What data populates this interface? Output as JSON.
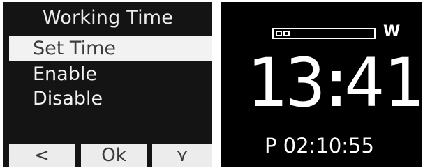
{
  "menu_screen": {
    "title": "Working Time",
    "items": [
      {
        "label": "Set Time",
        "selected": true
      },
      {
        "label": "Enable",
        "selected": false
      },
      {
        "label": "Disable",
        "selected": false
      }
    ],
    "softkeys": {
      "back_label": "<",
      "ok_label": "Ok",
      "down_label": "⋎"
    }
  },
  "clock_screen": {
    "progress_segments_filled": 2,
    "mode_letter": "W",
    "time": {
      "hours": "13",
      "separator": ":",
      "minutes": "41"
    },
    "status_line": "P 02:10:55"
  },
  "colors": {
    "menu_background": "#141414",
    "menu_text": "#f2f2f2",
    "selected_background": "#f2f2f2",
    "selected_text": "#3c3c3c",
    "softkey_background": "#ececec",
    "clock_background": "#000000",
    "clock_text": "#ffffff"
  }
}
